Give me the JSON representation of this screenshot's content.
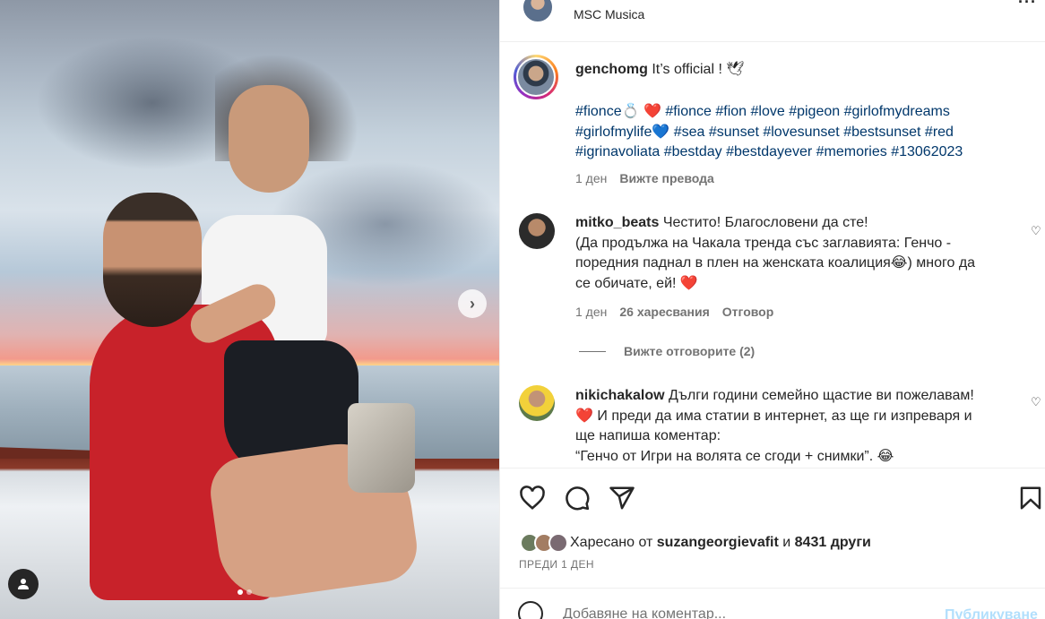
{
  "post": {
    "header": {
      "location": "MSC Musica",
      "more_icon": "more-horizontal-icon"
    },
    "carousel": {
      "next_glyph": "›",
      "dot_count": 2,
      "active_dot": 0
    },
    "caption": {
      "username": "genchomg",
      "text": "It’s official ! 🕊",
      "hashtags_line1": "#fionce💍 ❤️ #fionce #fion #love #pigeon #girlofmydreams",
      "hashtags_line2": "#girlofmylife💙 #sea #sunset #lovesunset #bestsunset #red",
      "hashtags_line3": "#igrinavoliata #bestday #bestdayever #memories #13062023",
      "time": "1 ден",
      "translate": "Вижте превода"
    },
    "comments": [
      {
        "username": "mitko_beats",
        "line1": "Честито! Благословени да сте!",
        "line2": "(Да продължа на Чакала тренда със заглавията: Генчо -",
        "line3": "поредния паднал в плен на женската коалиция😂) много да",
        "line4": "се обичате, ей! ❤️",
        "time": "1 ден",
        "likes": "26 харесвания",
        "reply": "Отговор",
        "view_replies": "Вижте отговорите (2)"
      },
      {
        "username": "nikichakalow",
        "line1": "Дълги години семейно щастие ви пожелавам!",
        "line2": "❤️  И преди да има статии в интернет, аз ще ги изпреваря и",
        "line3": "ще напиша коментар:",
        "line4": "“Генчо от Игри на волята се сгоди + снимки”. 😂"
      }
    ],
    "likes": {
      "prefix": "Харесано от",
      "user": "suzangeorgievafit",
      "conj": "и",
      "others": "8431 други"
    },
    "date": "ПРЕДИ 1 ДЕН",
    "add_comment": {
      "placeholder": "Добавяне на коментар...",
      "post_label": "Публикуване"
    },
    "colors": {
      "text": "#262626",
      "secondary": "#737373",
      "hashtag": "#00376b",
      "post_disabled": "#b2dffc",
      "divider": "#efefef"
    }
  }
}
